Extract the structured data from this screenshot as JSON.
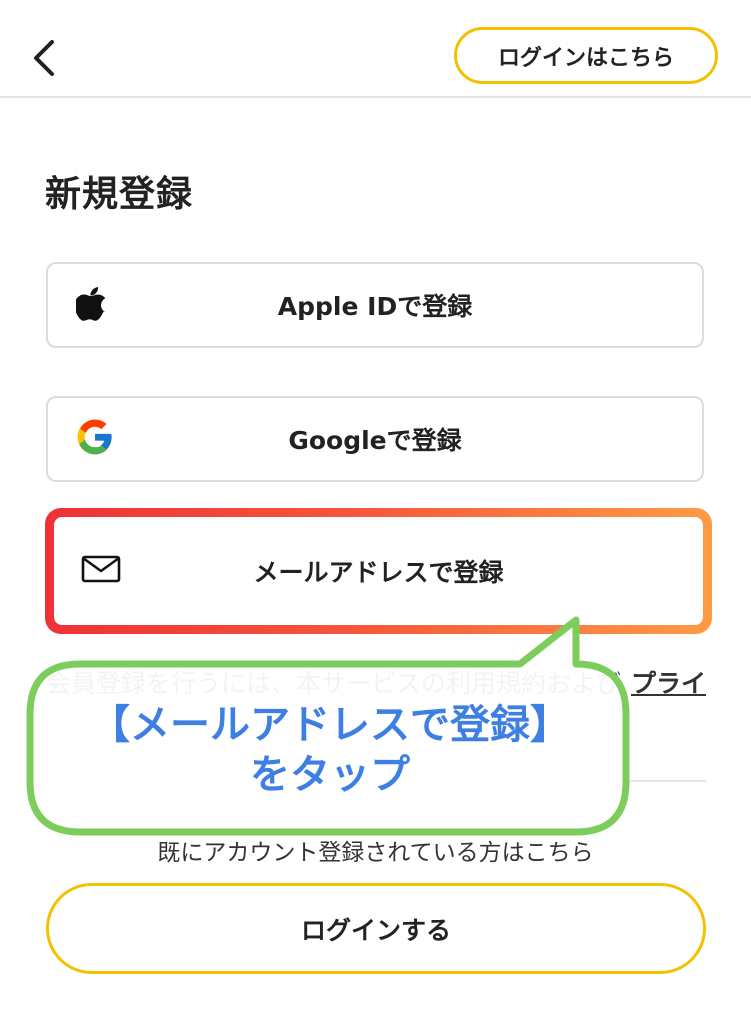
{
  "header": {
    "back_icon": "chevron-left-icon",
    "login_link_label": "ログインはこちら"
  },
  "page_title": "新規登録",
  "signup_options": [
    {
      "label": "Apple IDで登録",
      "icon": "apple-icon"
    },
    {
      "label": "Googleで登録",
      "icon": "google-icon"
    },
    {
      "label": "メールアドレスで登録",
      "icon": "mail-icon"
    }
  ],
  "terms": {
    "text": "会員登録を行うには、本サービスの利用規約および",
    "link_label": "プライ"
  },
  "callout": {
    "line1": "【メールアドレスで登録】",
    "line2": "をタップ",
    "text_color": "#3e7fe3",
    "border_color": "#7ccd5c"
  },
  "footer": {
    "already_text": "既にアカウント登録されている方はこちら",
    "login_button_label": "ログインする"
  },
  "colors": {
    "accent_yellow": "#f2c200",
    "highlight_gradient_start": "#ef3137",
    "highlight_gradient_end": "#ff9a45"
  }
}
